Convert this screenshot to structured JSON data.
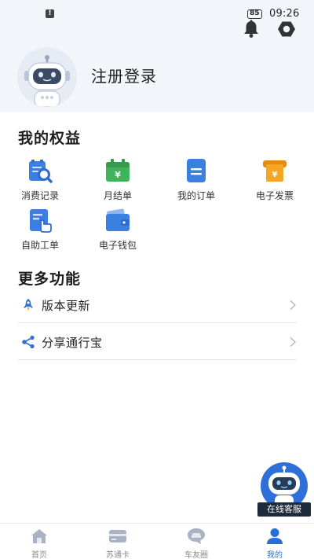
{
  "status_bar": {
    "battery": "85",
    "time": "09:26",
    "alert_icon": "alert-icon"
  },
  "header": {
    "login_label": "注册登录",
    "icons": [
      "bell-icon",
      "settings-icon"
    ],
    "avatar_icon": "robot-avatar-icon"
  },
  "benefits": {
    "title": "我的权益",
    "items": [
      {
        "label": "消费记录",
        "icon": "receipt-search-icon",
        "color": "#3b7fe0"
      },
      {
        "label": "月结单",
        "icon": "calendar-yen-icon",
        "color": "#3fb45a"
      },
      {
        "label": "我的订单",
        "icon": "order-document-icon",
        "color": "#3b7fe0"
      },
      {
        "label": "电子发票",
        "icon": "invoice-yen-icon",
        "color": "#f5a623"
      },
      {
        "label": "自助工单",
        "icon": "self-service-ticket-icon",
        "color": "#3b7fe0"
      },
      {
        "label": "电子钱包",
        "icon": "wallet-icon",
        "color": "#3b7fe0"
      }
    ]
  },
  "more": {
    "title": "更多功能",
    "items": [
      {
        "label": "版本更新",
        "icon": "rocket-icon"
      },
      {
        "label": "分享通行宝",
        "icon": "share-icon"
      }
    ]
  },
  "service": {
    "label": "在线客服",
    "icon": "robot-service-icon"
  },
  "tabs": [
    {
      "label": "首页",
      "icon": "home-icon",
      "active": false
    },
    {
      "label": "苏通卡",
      "icon": "card-icon",
      "active": false
    },
    {
      "label": "车友圈",
      "icon": "car-chat-icon",
      "active": false
    },
    {
      "label": "我的",
      "icon": "profile-icon",
      "active": true
    }
  ],
  "colors": {
    "accent": "#2a6fd6",
    "header_bg": "#f3f5fa",
    "tab_inactive": "#8a8a8a"
  }
}
